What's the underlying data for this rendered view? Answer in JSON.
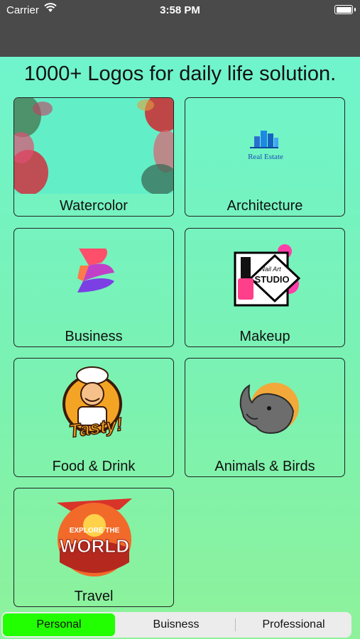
{
  "status_bar": {
    "carrier": "Carrier",
    "time": "3:58 PM"
  },
  "header": {
    "title": "1000+ Logos for daily life solution."
  },
  "categories": [
    {
      "label": "Watercolor"
    },
    {
      "label": "Architecture",
      "logo_text": "Real Estate"
    },
    {
      "label": "Business"
    },
    {
      "label": "Makeup",
      "logo_text_1": "Nail Art",
      "logo_text_2": "STUDIO"
    },
    {
      "label": "Food & Drink",
      "logo_text": "Tasty!"
    },
    {
      "label": "Animals & Birds"
    },
    {
      "label": "Travel",
      "logo_text_1": "EXPLORE THE",
      "logo_text_2": "WORLD"
    }
  ],
  "tabs": [
    {
      "label": "Personal",
      "active": true
    },
    {
      "label": "Buisness",
      "active": false
    },
    {
      "label": "Professional",
      "active": false
    }
  ],
  "colors": {
    "active_tab": "#22ff00",
    "gradient_top": "#6ff4cc",
    "gradient_bottom": "#8ef29a"
  }
}
